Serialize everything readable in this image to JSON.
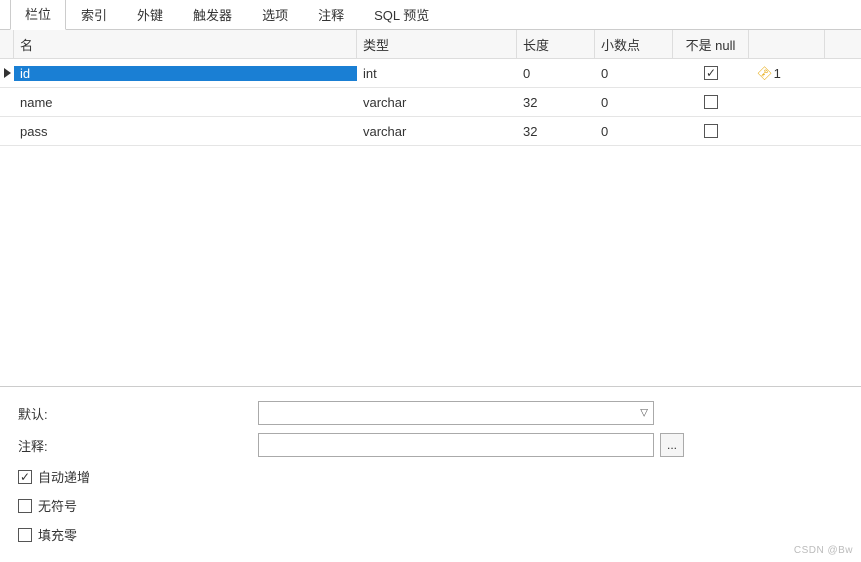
{
  "tabs": {
    "items": [
      {
        "label": "栏位",
        "active": true
      },
      {
        "label": "索引",
        "active": false
      },
      {
        "label": "外键",
        "active": false
      },
      {
        "label": "触发器",
        "active": false
      },
      {
        "label": "选项",
        "active": false
      },
      {
        "label": "注释",
        "active": false
      },
      {
        "label": "SQL 预览",
        "active": false
      }
    ]
  },
  "grid": {
    "headers": {
      "name": "名",
      "type": "类型",
      "length": "长度",
      "decimals": "小数点",
      "not_null": "不是 null",
      "key": ""
    },
    "rows": [
      {
        "name": "id",
        "type": "int",
        "length": "0",
        "decimals": "0",
        "not_null": true,
        "key_index": "1",
        "is_key": true,
        "selected": true
      },
      {
        "name": "name",
        "type": "varchar",
        "length": "32",
        "decimals": "0",
        "not_null": false,
        "key_index": "",
        "is_key": false,
        "selected": false
      },
      {
        "name": "pass",
        "type": "varchar",
        "length": "32",
        "decimals": "0",
        "not_null": false,
        "key_index": "",
        "is_key": false,
        "selected": false
      }
    ]
  },
  "form": {
    "default_label": "默认:",
    "default_value": "",
    "comment_label": "注释:",
    "comment_value": "",
    "more_btn": "...",
    "auto_increment_label": "自动递增",
    "auto_increment_checked": true,
    "unsigned_label": "无符号",
    "unsigned_checked": false,
    "zerofill_label": "填充零",
    "zerofill_checked": false
  },
  "watermark": "CSDN @Bw"
}
